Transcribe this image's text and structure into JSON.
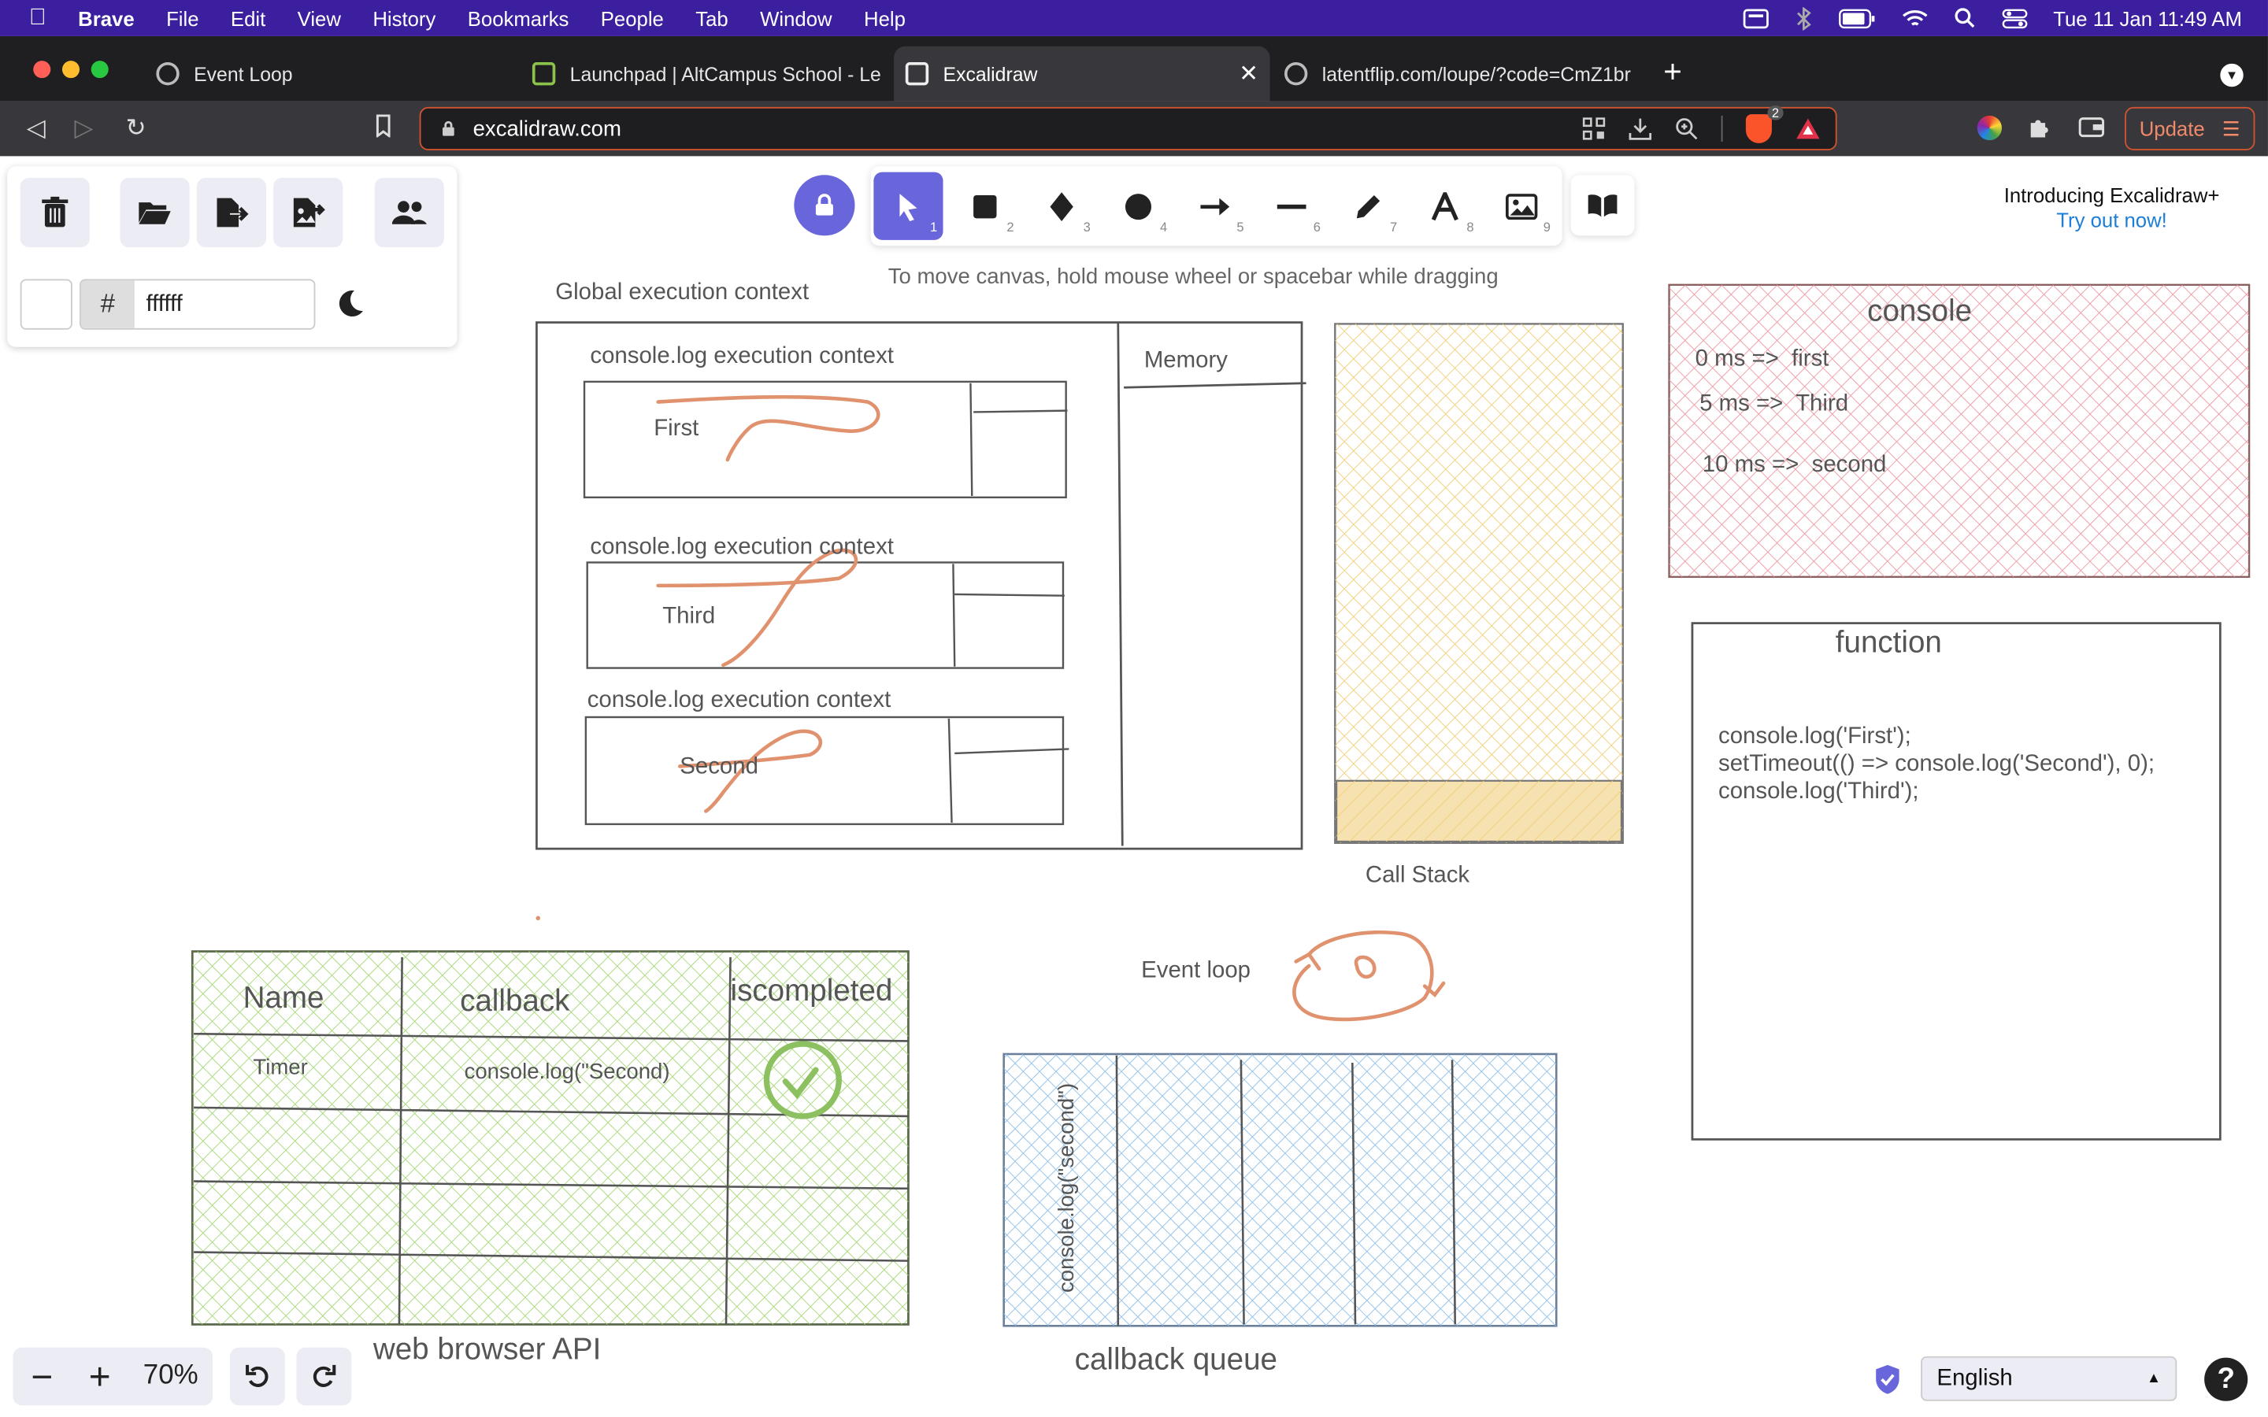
{
  "menubar": {
    "app": "Brave",
    "items": [
      "File",
      "Edit",
      "View",
      "History",
      "Bookmarks",
      "People",
      "Tab",
      "Window",
      "Help"
    ],
    "datetime": "Tue 11 Jan  11:49 AM"
  },
  "tabs": [
    {
      "title": "Event Loop"
    },
    {
      "title": "Launchpad | AltCampus School - Le"
    },
    {
      "title": "Excalidraw"
    },
    {
      "title": "latentflip.com/loupe/?code=CmZ1br"
    }
  ],
  "address": {
    "url": "excalidraw.com",
    "shields_count": "2",
    "update_label": "Update"
  },
  "excalidraw": {
    "background_hash": "#",
    "background_value": "ffffff",
    "tool_numbers": [
      "1",
      "2",
      "3",
      "4",
      "5",
      "6",
      "7",
      "8",
      "9"
    ],
    "hint": "To move canvas, hold mouse wheel or spacebar while dragging",
    "promo_title": "Introducing Excalidraw+",
    "promo_link": "Try out now!",
    "zoom": "70%",
    "language": "English",
    "help": "?"
  },
  "canvas": {
    "gec_title": "Global execution context",
    "memory": "Memory",
    "ctx_label": "console.log execution context",
    "ctx_values": [
      "First",
      "Third",
      "Second"
    ],
    "call_stack": "Call Stack",
    "console_title": "console",
    "console_lines": [
      "0 ms =>  first",
      "5 ms =>  Third",
      "10 ms =>  second"
    ],
    "function_title": "function",
    "function_code": [
      "console.log('First');",
      "setTimeout(() => console.log('Second'), 0);",
      "console.log('Third');"
    ],
    "event_loop": "Event loop",
    "api_headers": [
      "Name",
      "callback",
      "iscompleted"
    ],
    "api_row": [
      "Timer",
      "console.log(\"Second)"
    ],
    "api_caption": "web browser API",
    "queue_item": "console.log(\"second\")",
    "queue_caption": "callback queue"
  },
  "colors": {
    "menubar": "#3b1f9e",
    "accent": "#6965db",
    "console_fill": "#f0a6ae",
    "stack_fill": "#f6d98a",
    "api_fill": "#b2dd8a",
    "queue_fill": "#9cc7ea",
    "scribble": "#e0926e"
  }
}
